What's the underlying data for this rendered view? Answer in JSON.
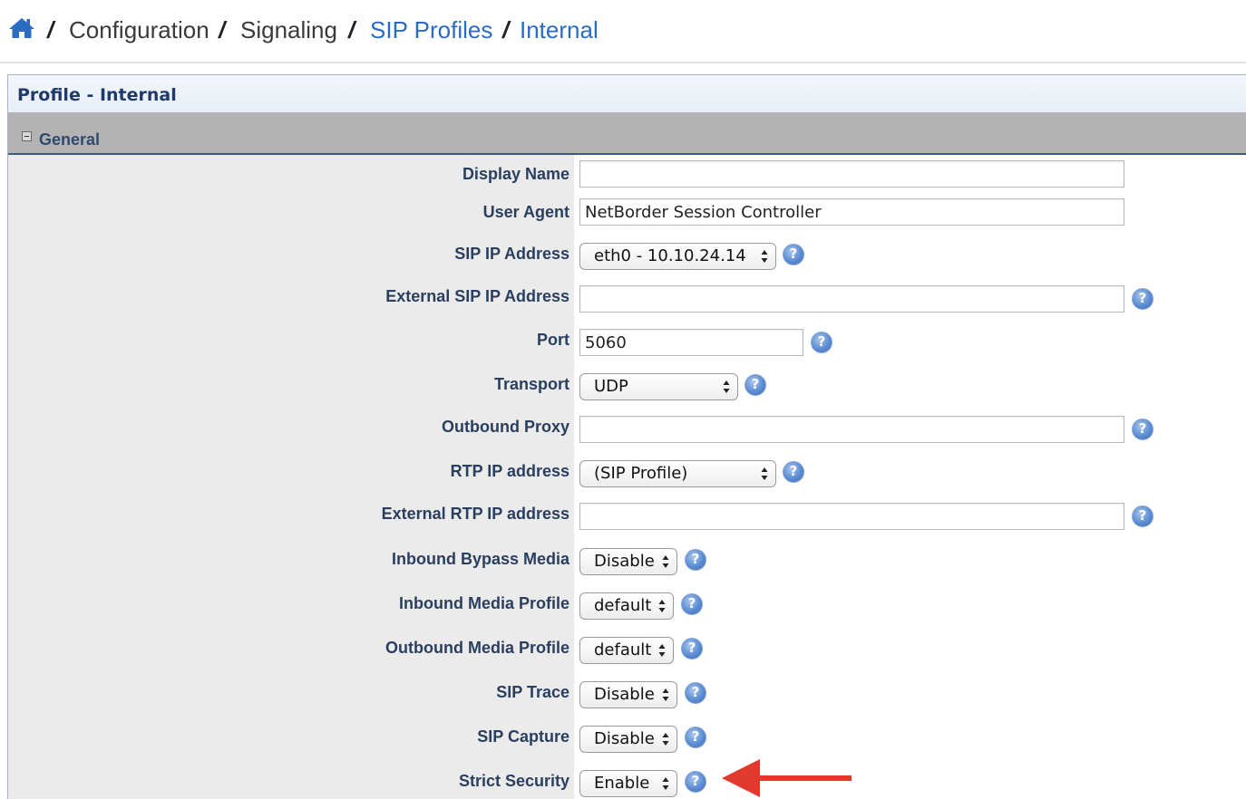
{
  "breadcrumb": {
    "home_icon": "home-icon",
    "separator": "/",
    "items": [
      "Configuration",
      "Signaling",
      "SIP Profiles",
      "Internal"
    ]
  },
  "panel": {
    "title": "Profile - Internal",
    "section": {
      "title": "General",
      "icon": "collapse-icon"
    }
  },
  "form": {
    "display_name": {
      "label": "Display Name",
      "value": ""
    },
    "user_agent": {
      "label": "User Agent",
      "value": "NetBorder Session Controller"
    },
    "sip_ip_address": {
      "label": "SIP IP Address",
      "value": "eth0 - 10.10.24.14"
    },
    "external_sip_ip_address": {
      "label": "External SIP IP Address",
      "value": ""
    },
    "port": {
      "label": "Port",
      "value": "5060"
    },
    "transport": {
      "label": "Transport",
      "value": "UDP"
    },
    "outbound_proxy": {
      "label": "Outbound Proxy",
      "value": ""
    },
    "rtp_ip_address": {
      "label": "RTP IP address",
      "value": "(SIP Profile)"
    },
    "external_rtp_ip_address": {
      "label": "External RTP IP address",
      "value": ""
    },
    "inbound_bypass_media": {
      "label": "Inbound Bypass Media",
      "value": "Disable"
    },
    "inbound_media_profile": {
      "label": "Inbound Media Profile",
      "value": "default"
    },
    "outbound_media_profile": {
      "label": "Outbound Media Profile",
      "value": "default"
    },
    "sip_trace": {
      "label": "SIP Trace",
      "value": "Disable"
    },
    "sip_capture": {
      "label": "SIP Capture",
      "value": "Disable"
    },
    "strict_security": {
      "label": "Strict Security",
      "value": "Enable"
    }
  },
  "colors": {
    "link": "#2a6cc0",
    "label": "#2a3f5f",
    "section_bar": "#b3b3b3",
    "annotation_arrow": "#e03a2f"
  }
}
